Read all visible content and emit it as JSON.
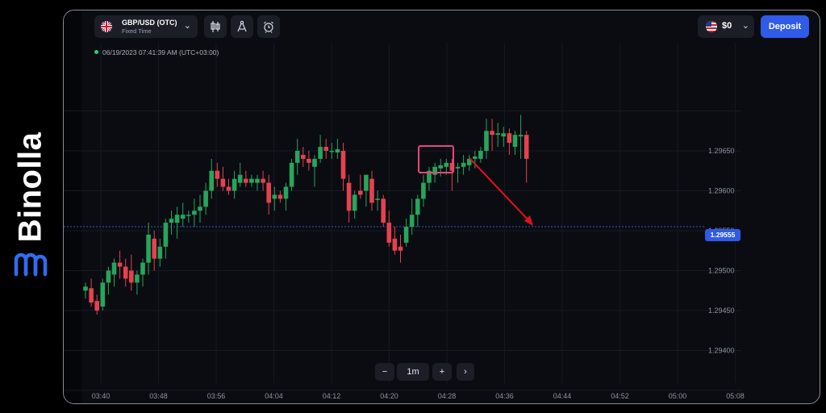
{
  "brand": {
    "name": "Binolla"
  },
  "header": {
    "pair_name": "GBP/USD (OTC)",
    "pair_type": "Fixed Time",
    "balance": "$0",
    "deposit_label": "Deposit"
  },
  "timestamp": "06/19/2023 07:41:39 AM (UTC+03:00)",
  "current_price": "1.29555",
  "zoom": {
    "minus": "−",
    "interval": "1m",
    "plus": "+",
    "next": "›"
  },
  "icons": [
    "pair-chevron-down-icon",
    "candlestick-icon",
    "drawing-compass-icon",
    "alarm-clock-icon",
    "balance-chevron-down-icon",
    "chevron-right-icon"
  ],
  "colors": {
    "up": "#26a65b",
    "down": "#e5414f",
    "accent": "#2f5be8",
    "highlight": "#e8467c",
    "arrow": "#e0121a"
  },
  "chart_data": {
    "type": "candlestick",
    "y_ticks": [
      "1.29650",
      "1.29600",
      "1.29550",
      "1.29500",
      "1.29450",
      "1.29400"
    ],
    "x_ticks": [
      "03:40",
      "03:48",
      "03:56",
      "04:04",
      "04:12",
      "04:20",
      "04:28",
      "04:36",
      "04:44",
      "04:52",
      "05:00",
      "05:08"
    ],
    "ylim": [
      1.29375,
      1.29675
    ],
    "current_price": 1.29555,
    "candles": [
      [
        1.29475,
        1.29485,
        1.29465,
        1.2948
      ],
      [
        1.29478,
        1.2949,
        1.29455,
        1.2946
      ],
      [
        1.29462,
        1.2947,
        1.29445,
        1.2945
      ],
      [
        1.29455,
        1.2949,
        1.2945,
        1.29485
      ],
      [
        1.29485,
        1.29505,
        1.2947,
        1.295
      ],
      [
        1.29495,
        1.29515,
        1.2948,
        1.2951
      ],
      [
        1.2951,
        1.29525,
        1.2949,
        1.29505
      ],
      [
        1.29505,
        1.29515,
        1.2948,
        1.2949
      ],
      [
        1.295,
        1.2952,
        1.29475,
        1.29485
      ],
      [
        1.29485,
        1.295,
        1.2947,
        1.29495
      ],
      [
        1.29495,
        1.29515,
        1.2948,
        1.2951
      ],
      [
        1.2951,
        1.2956,
        1.29495,
        1.29545
      ],
      [
        1.2954,
        1.2955,
        1.295,
        1.29515
      ],
      [
        1.29515,
        1.2954,
        1.29505,
        1.2953
      ],
      [
        1.2953,
        1.29565,
        1.29515,
        1.2956
      ],
      [
        1.2956,
        1.29575,
        1.29545,
        1.29565
      ],
      [
        1.2956,
        1.2958,
        1.2954,
        1.2957
      ],
      [
        1.29565,
        1.29585,
        1.29555,
        1.2957
      ],
      [
        1.2957,
        1.29575,
        1.2956,
        1.2957
      ],
      [
        1.2957,
        1.2959,
        1.29555,
        1.29575
      ],
      [
        1.29575,
        1.29595,
        1.2956,
        1.2958
      ],
      [
        1.2958,
        1.2961,
        1.2957,
        1.296
      ],
      [
        1.296,
        1.2964,
        1.2959,
        1.29625
      ],
      [
        1.29625,
        1.29635,
        1.29605,
        1.29615
      ],
      [
        1.29615,
        1.2963,
        1.296,
        1.29605
      ],
      [
        1.29605,
        1.29615,
        1.29595,
        1.296
      ],
      [
        1.296,
        1.29625,
        1.2959,
        1.29615
      ],
      [
        1.2961,
        1.29635,
        1.29605,
        1.2962
      ],
      [
        1.29615,
        1.29625,
        1.29605,
        1.2961
      ],
      [
        1.2961,
        1.2962,
        1.29605,
        1.29615
      ],
      [
        1.2961,
        1.2962,
        1.296,
        1.29615
      ],
      [
        1.29615,
        1.29625,
        1.296,
        1.2961
      ],
      [
        1.2961,
        1.2962,
        1.2957,
        1.29585
      ],
      [
        1.2959,
        1.29605,
        1.29575,
        1.29595
      ],
      [
        1.29595,
        1.296,
        1.29585,
        1.2959
      ],
      [
        1.2959,
        1.2961,
        1.29575,
        1.29605
      ],
      [
        1.29605,
        1.2964,
        1.296,
        1.29635
      ],
      [
        1.29635,
        1.29665,
        1.2962,
        1.2965
      ],
      [
        1.29645,
        1.29655,
        1.2963,
        1.2964
      ],
      [
        1.2964,
        1.2965,
        1.29625,
        1.29635
      ],
      [
        1.2963,
        1.29645,
        1.29605,
        1.2964
      ],
      [
        1.2964,
        1.2967,
        1.29635,
        1.29655
      ],
      [
        1.29655,
        1.29665,
        1.2964,
        1.2965
      ],
      [
        1.2965,
        1.2966,
        1.2964,
        1.2965
      ],
      [
        1.29648,
        1.29665,
        1.2964,
        1.29652
      ],
      [
        1.2965,
        1.2966,
        1.296,
        1.29615
      ],
      [
        1.2961,
        1.2962,
        1.2956,
        1.29575
      ],
      [
        1.29575,
        1.296,
        1.29565,
        1.29595
      ],
      [
        1.296,
        1.2962,
        1.2959,
        1.29595
      ],
      [
        1.296,
        1.29615,
        1.2958,
        1.2962
      ],
      [
        1.29615,
        1.29625,
        1.29575,
        1.29585
      ],
      [
        1.2959,
        1.296,
        1.29575,
        1.2959
      ],
      [
        1.2959,
        1.29595,
        1.29555,
        1.2956
      ],
      [
        1.2956,
        1.29575,
        1.2953,
        1.29535
      ],
      [
        1.2954,
        1.29555,
        1.2952,
        1.29525
      ],
      [
        1.2953,
        1.29545,
        1.2951,
        1.29525
      ],
      [
        1.29535,
        1.29565,
        1.2953,
        1.29555
      ],
      [
        1.29555,
        1.2959,
        1.29545,
        1.2957
      ],
      [
        1.2957,
        1.29595,
        1.29555,
        1.2959
      ],
      [
        1.2959,
        1.2962,
        1.2958,
        1.2961
      ],
      [
        1.2961,
        1.2963,
        1.296,
        1.29625
      ],
      [
        1.2962,
        1.29635,
        1.2961,
        1.2963
      ],
      [
        1.29628,
        1.2964,
        1.29618,
        1.29632
      ],
      [
        1.2963,
        1.2964,
        1.2962,
        1.29635
      ],
      [
        1.29635,
        1.2964,
        1.296,
        1.29625
      ],
      [
        1.29628,
        1.29635,
        1.2961,
        1.2963
      ],
      [
        1.2963,
        1.29645,
        1.2962,
        1.29635
      ],
      [
        1.29632,
        1.29645,
        1.29625,
        1.2964
      ],
      [
        1.2964,
        1.2965,
        1.29628,
        1.29643
      ],
      [
        1.2964,
        1.29655,
        1.29635,
        1.2965
      ],
      [
        1.2965,
        1.2969,
        1.2964,
        1.29675
      ],
      [
        1.29675,
        1.2969,
        1.2965,
        1.2967
      ],
      [
        1.2967,
        1.29685,
        1.29655,
        1.29672
      ],
      [
        1.29668,
        1.2968,
        1.29655,
        1.29672
      ],
      [
        1.29672,
        1.29678,
        1.29645,
        1.2966
      ],
      [
        1.29655,
        1.29675,
        1.29645,
        1.2967
      ],
      [
        1.29668,
        1.29695,
        1.2964,
        1.2967
      ],
      [
        1.2967,
        1.29675,
        1.2961,
        1.2964
      ]
    ]
  }
}
